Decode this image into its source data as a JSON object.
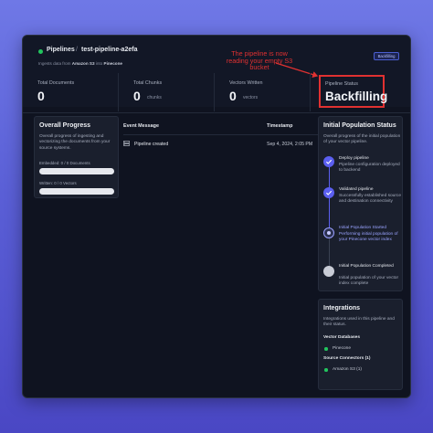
{
  "header": {
    "breadcrumb_root": "Pipelines",
    "pipeline_name": "test-pipeline-a2efa",
    "subtitle_prefix": "Ingests data from",
    "source": "Amazon S3",
    "subtitle_mid": "into",
    "destination": "Pinecone",
    "badge": "Backfilling"
  },
  "annotation": "The pipeline is now reading your empty S3 bucket",
  "metrics": {
    "total_documents_label": "Total Documents",
    "total_documents_value": "0",
    "total_chunks_label": "Total Chunks",
    "total_chunks_value": "0",
    "total_chunks_unit": "chunks",
    "vectors_written_label": "Vectors Written",
    "vectors_written_value": "0",
    "vectors_written_unit": "vectors",
    "pipeline_status_label": "Pipeline Status",
    "pipeline_status_value": "Backfilling"
  },
  "overall_progress": {
    "title": "Overall Progress",
    "description": "Overall progress of ingesting and vectorizing the documents from your source systems.",
    "embedded_label": "Embedded: 0 / 0 Documents",
    "embedded_fraction": 0,
    "written_label": "Written: 0 / 0 Vectors",
    "written_fraction": 0
  },
  "events": {
    "col_message": "Event Message",
    "col_timestamp": "Timestamp",
    "rows": [
      {
        "message": "Pipeline created",
        "timestamp": "Sep 4, 2024, 2:05 PM"
      }
    ]
  },
  "initial_population": {
    "title": "Initial Population Status",
    "description": "Overall progress of the initial population of your vector pipeline.",
    "steps": [
      {
        "title": "Deploy pipeline",
        "text": "Pipeline configuration deployed to backend",
        "state": "done"
      },
      {
        "title": "Validated pipeline",
        "text": "Successfully established source and destination connectivity",
        "state": "done"
      },
      {
        "title": "Initial Population Started",
        "text": "Performing initial population of your Pinecone vector index",
        "state": "active"
      },
      {
        "title": "Initial Population Completed",
        "text": "Initial population of your vector index complete",
        "state": "pending"
      }
    ]
  },
  "integrations": {
    "title": "Integrations",
    "description": "Integrations used in this pipeline and their status.",
    "vector_db_label": "Vector Databases",
    "vector_db_item": "Pinecone",
    "source_label": "Source Connectors (1)",
    "source_item": "Amazon S3 (1)"
  },
  "colors": {
    "accent": "#5b5ff0",
    "annotation_red": "#e03131",
    "status_green": "#22c55e"
  }
}
